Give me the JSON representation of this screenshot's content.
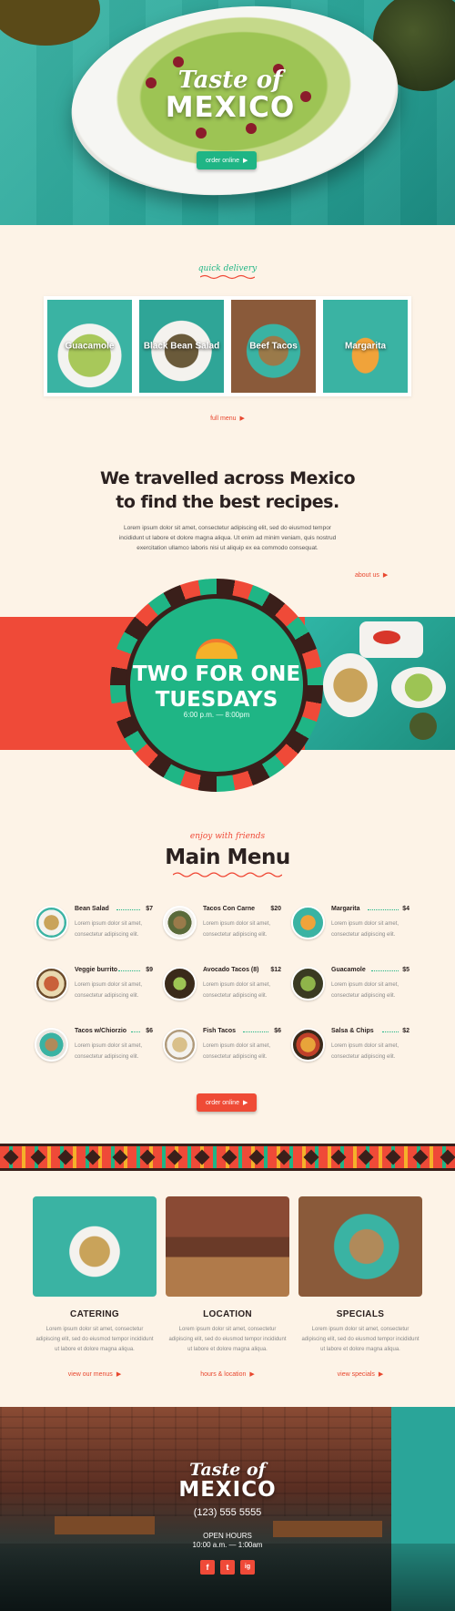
{
  "hero": {
    "logo_line1": "Taste of",
    "logo_line2": "MEXICO",
    "cta": "order online"
  },
  "delivery": {
    "heading": "quick delivery",
    "cards": [
      "Guacamole",
      "Black Bean Salad",
      "Beef Tacos",
      "Margarita"
    ],
    "link": "full menu"
  },
  "story": {
    "title_line1": "We travelled across Mexico",
    "title_line2": "to find the best recipes.",
    "body_line1": "Lorem ipsum dolor sit amet, consectetur adipiscing elit, sed do eiusmod tempor",
    "body_line2": "incididunt ut labore et dolore magna aliqua. Ut enim ad minim veniam, quis nostrud",
    "body_line3": "exercitation ullamco laboris nisi ut aliquip ex ea commodo consequat.",
    "link": "about us"
  },
  "promo": {
    "line1": "TWO FOR ONE",
    "line2": "TUESDAYS",
    "hours": "6:00 p.m. — 8:00pm"
  },
  "menu": {
    "kicker": "enjoy with friends",
    "title": "Main Menu",
    "desc1": "Lorem ipsum dolor sit amet,",
    "desc2": "consectetur adipiscing elit.",
    "items": [
      {
        "name": "Bean Salad",
        "price": "$7"
      },
      {
        "name": "Tacos Con Carne",
        "price": "$20"
      },
      {
        "name": "Margarita",
        "price": "$4"
      },
      {
        "name": "Veggie burrito",
        "price": "$9"
      },
      {
        "name": "Avocado Tacos (8)",
        "price": "$12"
      },
      {
        "name": "Guacamole",
        "price": "$5"
      },
      {
        "name": "Tacos w/Chiorzio",
        "price": "$6"
      },
      {
        "name": "Fish Tacos",
        "price": "$6"
      },
      {
        "name": "Salsa & Chips",
        "price": "$2"
      }
    ],
    "cta": "order online"
  },
  "info": [
    {
      "title": "CATERING",
      "l1": "Lorem ipsum dolor sit amet, consectetur",
      "l2": "adipiscing elit, sed do eiusmod tempor incididunt",
      "l3": "ut labore et dolore magna aliqua.",
      "link": "view our menus"
    },
    {
      "title": "LOCATION",
      "l1": "Lorem ipsum dolor sit amet, consectetur",
      "l2": "adipiscing elit, sed do eiusmod tempor incididunt",
      "l3": "ut labore et dolore magna aliqua.",
      "link": "hours & location"
    },
    {
      "title": "SPECIALS",
      "l1": "Lorem ipsum dolor sit amet, consectetur",
      "l2": "adipiscing elit, sed do eiusmod tempor incididunt",
      "l3": "ut labore et dolore magna aliqua.",
      "link": "view specials"
    }
  ],
  "footer": {
    "logo_line1": "Taste of",
    "logo_line2": "MEXICO",
    "phone": "(123) 555 5555",
    "hours_label": "OPEN HOURS",
    "hours": "10:00 a.m. — 1:00am",
    "social": [
      "f",
      "t",
      "ig"
    ]
  },
  "colors": {
    "accent_red": "#ef4a38",
    "accent_green": "#1fb585",
    "dark_brown": "#3a1f1a",
    "cream": "#fdf3e7"
  }
}
